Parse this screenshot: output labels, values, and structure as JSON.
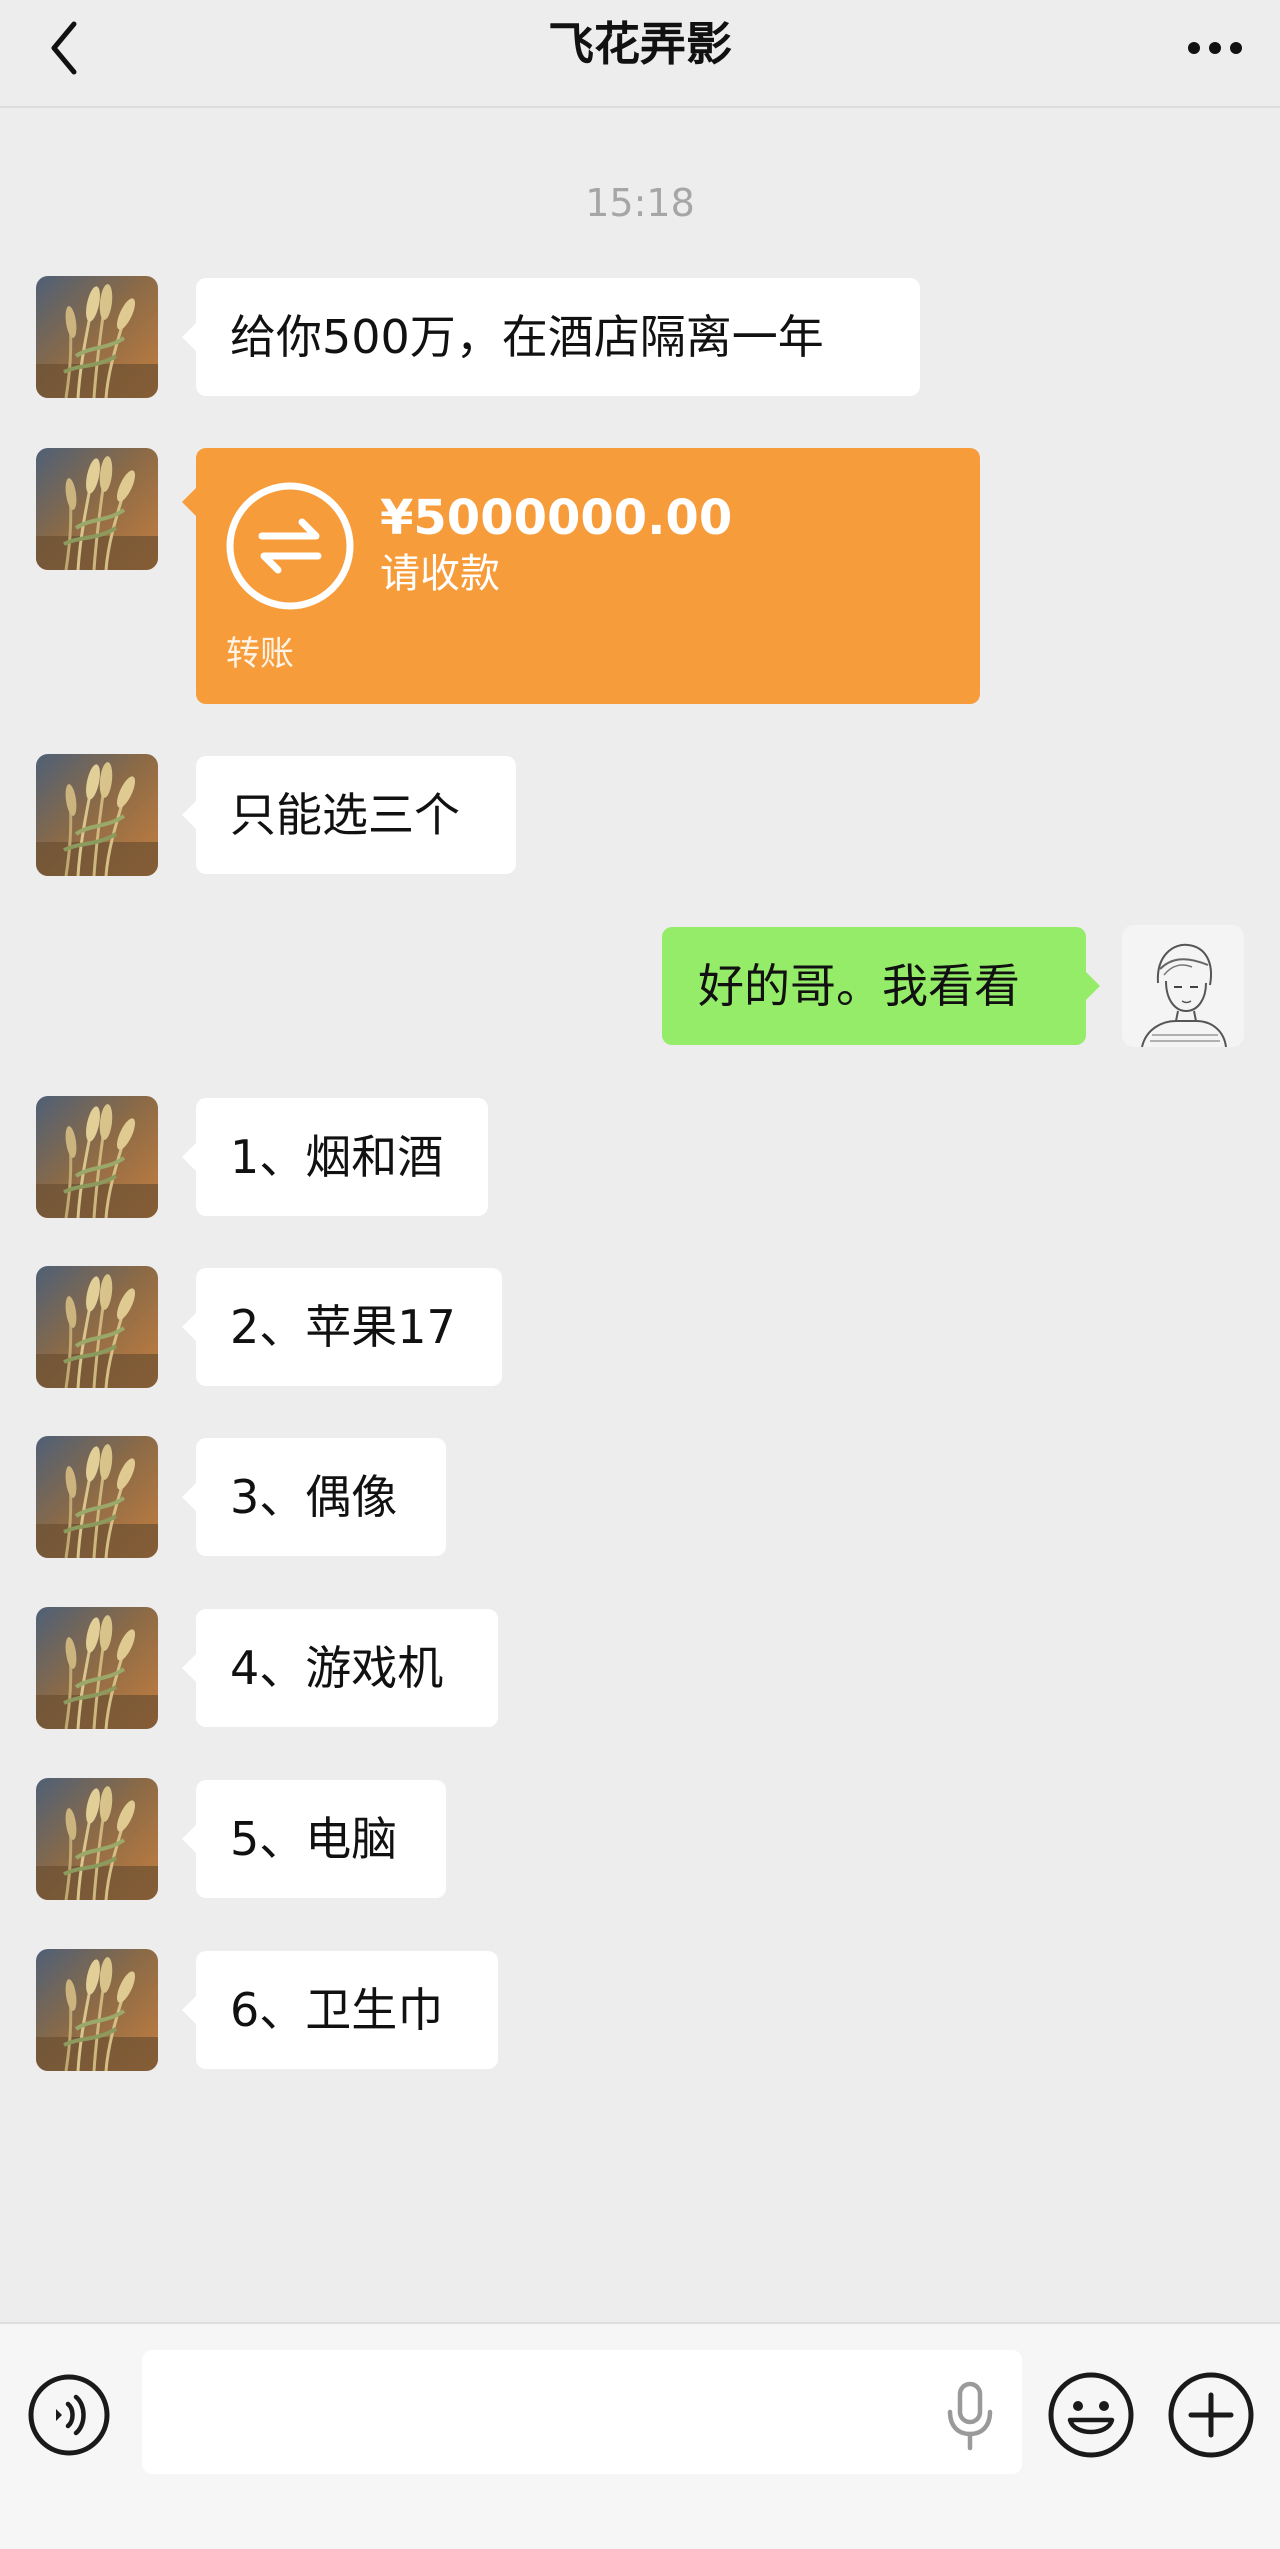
{
  "header": {
    "title": "飞花弄影"
  },
  "chat": {
    "timestamp": "15:18",
    "messages": [
      {
        "sender": "contact",
        "text": "给你500万，在酒店隔离一年"
      },
      {
        "sender": "contact",
        "type": "transfer",
        "amount": "¥5000000.00",
        "status": "请收款",
        "label": "转账"
      },
      {
        "sender": "contact",
        "text": "只能选三个"
      },
      {
        "sender": "me",
        "text": "好的哥。我看看"
      },
      {
        "sender": "contact",
        "text": "1、烟和酒"
      },
      {
        "sender": "contact",
        "text": "2、苹果17"
      },
      {
        "sender": "contact",
        "text": "3、偶像"
      },
      {
        "sender": "contact",
        "text": "4、游戏机"
      },
      {
        "sender": "contact",
        "text": "5、电脑"
      },
      {
        "sender": "contact",
        "text": "6、卫生巾"
      }
    ]
  },
  "input": {
    "value": "",
    "placeholder": ""
  },
  "icons": {
    "back": "chevron-left-icon",
    "more": "more-dots-icon",
    "voice": "voice-input-icon",
    "mic": "microphone-icon",
    "emoji": "emoji-icon",
    "plus": "plus-icon",
    "transfer": "transfer-arrows-icon"
  },
  "colors": {
    "background": "#ededed",
    "incoming_bubble": "#ffffff",
    "outgoing_bubble": "#95ec69",
    "transfer_card": "#f79c3a",
    "timestamp": "#a6a6a6"
  }
}
